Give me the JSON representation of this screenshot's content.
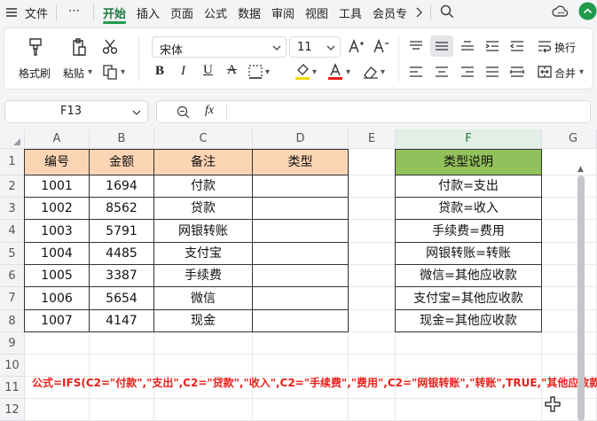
{
  "top_menu": {
    "file": "文件",
    "more": "⋯",
    "tabs": [
      "开始",
      "插入",
      "页面",
      "公式",
      "数据",
      "审阅",
      "视图",
      "工具",
      "会员专"
    ],
    "active_tab": "开始"
  },
  "ribbon": {
    "format_painter": "格式刷",
    "paste": "粘贴",
    "font_name": "宋体",
    "font_size": "11",
    "wrap": "换行",
    "merge": "合并"
  },
  "formula_bar": {
    "cell_ref": "F13",
    "fx": "fx",
    "content": ""
  },
  "columns": [
    "A",
    "B",
    "C",
    "D",
    "E",
    "F",
    "G"
  ],
  "rows": [
    "1",
    "2",
    "3",
    "4",
    "5",
    "6",
    "7",
    "8",
    "9",
    "10",
    "11",
    "12"
  ],
  "table": {
    "headers": [
      "编号",
      "金额",
      "备注",
      "类型"
    ],
    "rows": [
      [
        "1001",
        "1694",
        "付款",
        ""
      ],
      [
        "1002",
        "8562",
        "贷款",
        ""
      ],
      [
        "1003",
        "5791",
        "网银转账",
        ""
      ],
      [
        "1004",
        "4485",
        "支付宝",
        ""
      ],
      [
        "1005",
        "3387",
        "手续费",
        ""
      ],
      [
        "1006",
        "5654",
        "微信",
        ""
      ],
      [
        "1007",
        "4147",
        "现金",
        ""
      ]
    ]
  },
  "legend_table": {
    "header": "类型说明",
    "items": [
      "付款=支出",
      "贷款=收入",
      "手续费=费用",
      "网银转账=转账",
      "微信=其他应收款",
      "支付宝=其他应收款",
      "现金=其他应收款"
    ]
  },
  "formula_note": "公式=IFS(C2=\"付款\",\"支出\",C2=\"贷款\",\"收入\",C2=\"手续费\",\"费用\",C2=\"网银转账\",\"转账\",TRUE,\"其他应收款\")",
  "colors": {
    "header_fill": "#fcd5b4",
    "legend_header_fill": "#92c05a",
    "note_text": "#e8201a",
    "accent": "#1f9a4a"
  }
}
